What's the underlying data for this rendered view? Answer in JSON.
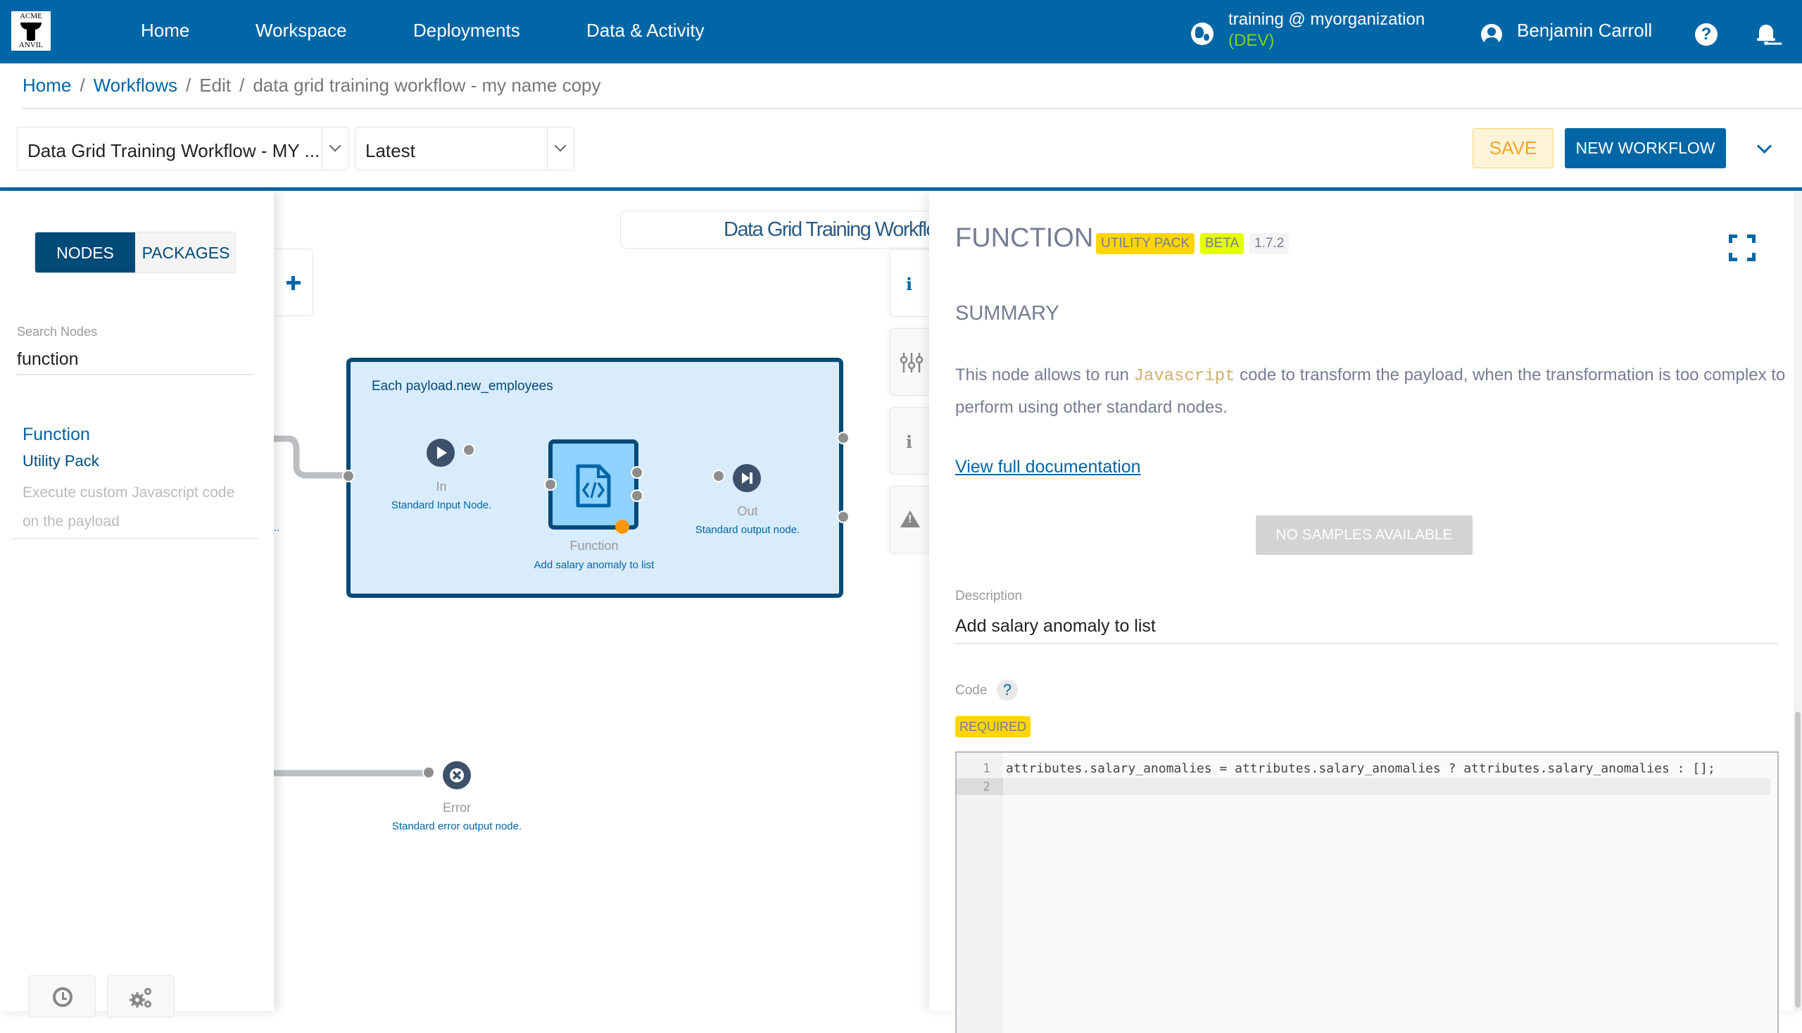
{
  "navbar": {
    "logo_top": "ACME",
    "logo_bottom": "ANVIL",
    "links": [
      "Home",
      "Workspace",
      "Deployments",
      "Data & Activity"
    ],
    "org": "training @ myorganization",
    "env": "(DEV)",
    "user": "Benjamin Carroll",
    "help": "?",
    "env_color": "#7ed321",
    "brand_color": "#0066a5"
  },
  "breadcrumb": {
    "items": [
      "Home",
      "Workflows",
      "Edit",
      "data grid training workflow - my name copy"
    ],
    "separator": "/"
  },
  "toolbar": {
    "workflow_select": "Data Grid Training Workflow - MY ...",
    "version_select": "Latest",
    "save_label": "SAVE",
    "new_workflow_label": "NEW WORKFLOW"
  },
  "left_panel": {
    "tabs": [
      "NODES",
      "PACKAGES"
    ],
    "active_tab": "NODES",
    "search_label": "Search Nodes",
    "search_value": "function",
    "results": [
      {
        "title": "Function",
        "package": "Utility Pack",
        "description": "Execute custom Javascript code on the payload"
      }
    ]
  },
  "canvas": {
    "workflow_title": "Data Grid Training Workflow",
    "group": {
      "label": "Each payload.new_employees"
    },
    "nodes": {
      "in": {
        "title": "In",
        "subtitle": "Standard Input Node."
      },
      "function": {
        "title": "Function",
        "subtitle": "Add salary anomaly to list"
      },
      "out": {
        "title": "Out",
        "subtitle": "Standard output node."
      },
      "error": {
        "title": "Error",
        "subtitle": "Standard error output node."
      }
    },
    "truncated_label": ".."
  },
  "right_panel": {
    "title": "FUNCTION",
    "badges": [
      "UTILITY PACK",
      "BETA",
      "1.7.2"
    ],
    "summary_heading": "SUMMARY",
    "summary_before": "This node allows to run ",
    "summary_code": "Javascript",
    "summary_after": " code to transform the payload, when the transformation is too complex to perform using other standard nodes.",
    "doc_link": "View full documentation",
    "no_samples_label": "NO SAMPLES AVAILABLE",
    "description_label": "Description",
    "description_value": "Add salary anomaly to list",
    "code_label": "Code",
    "code_help": "?",
    "required_label": "REQUIRED",
    "code_lines": [
      "attributes.salary_anomalies = attributes.salary_anomalies ? attributes.salary_anomalies : [];",
      ""
    ],
    "line_numbers": [
      "1",
      "2"
    ]
  }
}
